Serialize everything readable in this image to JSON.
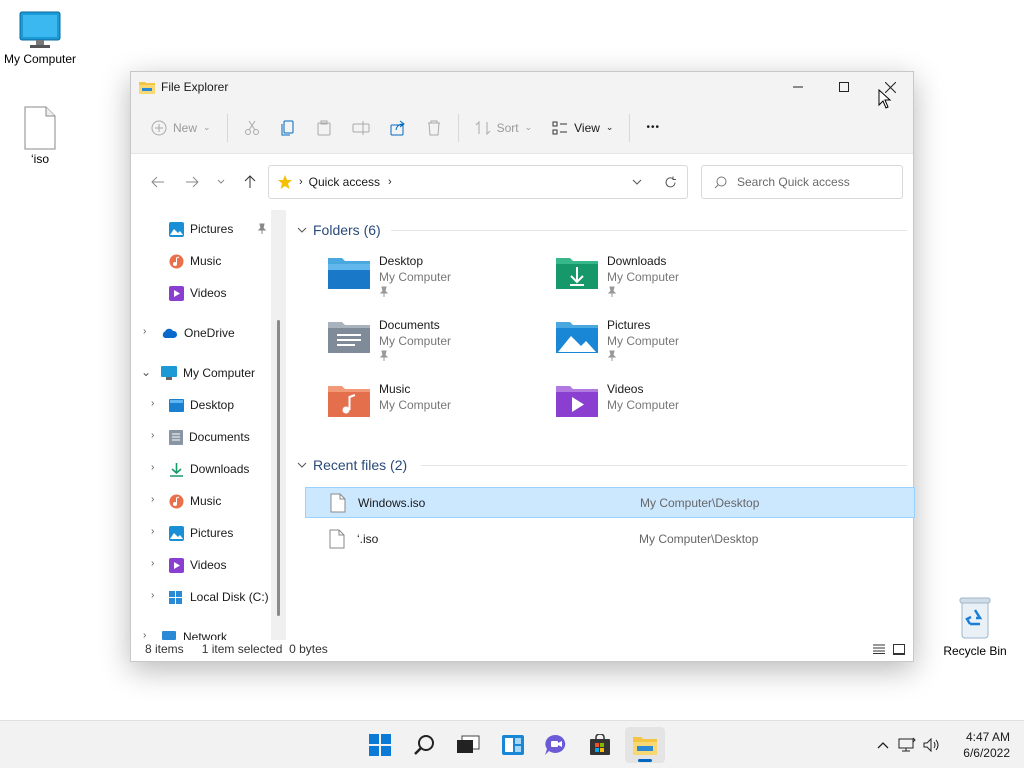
{
  "desktop": {
    "icons": [
      {
        "label": "My Computer",
        "icon": "monitor-icon"
      },
      {
        "label": "‘iso",
        "icon": "file-icon"
      },
      {
        "label": "Recycle Bin",
        "icon": "recycle-bin-icon"
      }
    ]
  },
  "window": {
    "title": "File Explorer",
    "commandbar": {
      "new_label": "New",
      "sort_label": "Sort",
      "view_label": "View",
      "more_label": "•••"
    },
    "address": {
      "crumb": "Quick access"
    },
    "search": {
      "placeholder": "Search Quick access"
    },
    "sidebar": {
      "items": [
        {
          "label": "Pictures",
          "icon": "pictures-icon"
        },
        {
          "label": "Music",
          "icon": "music-icon"
        },
        {
          "label": "Videos",
          "icon": "videos-icon"
        },
        {
          "label": "OneDrive",
          "icon": "onedrive-icon"
        },
        {
          "label": "My Computer",
          "icon": "computer-icon"
        },
        {
          "label": "Desktop",
          "icon": "desktop-icon"
        },
        {
          "label": "Documents",
          "icon": "documents-icon"
        },
        {
          "label": "Downloads",
          "icon": "downloads-icon"
        },
        {
          "label": "Music",
          "icon": "music-icon"
        },
        {
          "label": "Pictures",
          "icon": "pictures-icon"
        },
        {
          "label": "Videos",
          "icon": "videos-icon"
        },
        {
          "label": "Local Disk (C:)",
          "icon": "disk-icon"
        },
        {
          "label": "Network",
          "icon": "network-icon"
        }
      ]
    },
    "folders": {
      "header": "Folders (6)",
      "items": [
        {
          "name": "Desktop",
          "location": "My Computer",
          "pinned": true
        },
        {
          "name": "Downloads",
          "location": "My Computer",
          "pinned": true
        },
        {
          "name": "Documents",
          "location": "My Computer",
          "pinned": true
        },
        {
          "name": "Pictures",
          "location": "My Computer",
          "pinned": true
        },
        {
          "name": "Music",
          "location": "My Computer",
          "pinned": false
        },
        {
          "name": "Videos",
          "location": "My Computer",
          "pinned": false
        }
      ]
    },
    "recent": {
      "header": "Recent files (2)",
      "items": [
        {
          "name": "Windows.iso",
          "location": "My Computer\\Desktop",
          "selected": true
        },
        {
          "name": "‘.iso",
          "location": "My Computer\\Desktop",
          "selected": false
        }
      ]
    },
    "status": {
      "count": "8 items",
      "selection": "1 item selected",
      "size": "0 bytes"
    }
  },
  "taskbar": {
    "apps": [
      "start-icon",
      "search-icon",
      "task-view-icon",
      "widgets-icon",
      "chat-icon",
      "store-icon",
      "file-explorer-icon"
    ],
    "time": "4:47 AM",
    "date": "6/6/2022"
  },
  "colors": {
    "accent": "#0067c0",
    "selection_bg": "#cce8ff",
    "selection_border": "#99d1ff",
    "folder_yellow": "#f4c542"
  }
}
